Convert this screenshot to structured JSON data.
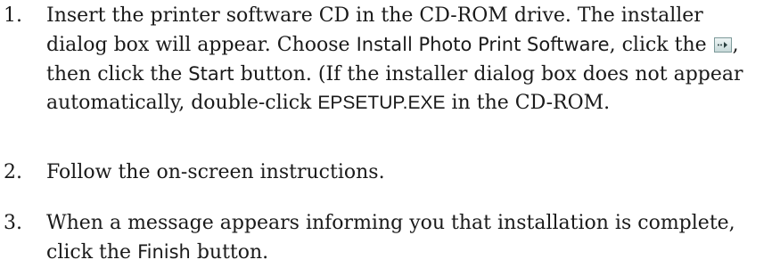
{
  "steps": [
    {
      "number": "1.",
      "parts": [
        "Insert the printer software CD in the CD-ROM drive. The installer dialog box will appear. Choose ",
        "Install Photo Print Software",
        ", click the ",
        ", then click the ",
        "Start",
        " button. (If the installer dialog box does not appear automatically, double-click ",
        "EPSETUP.EXE",
        " in the CD-ROM."
      ],
      "arrow_button_icon": "right-arrow-button-icon"
    },
    {
      "number": "2.",
      "text": "Follow the on-screen instructions."
    },
    {
      "number": "3.",
      "parts": [
        "When a message appears informing you that installation is complete, click the ",
        "Finish",
        " button."
      ]
    }
  ]
}
